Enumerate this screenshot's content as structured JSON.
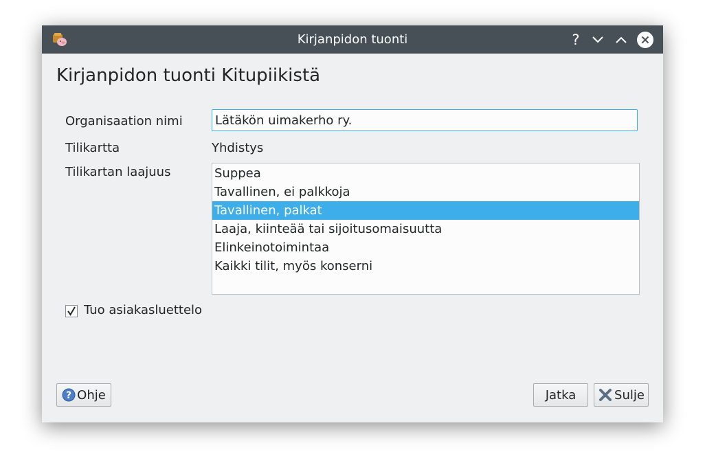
{
  "window": {
    "title": "Kirjanpidon tuonti",
    "controls": {
      "help": "?"
    }
  },
  "dialog": {
    "heading": "Kirjanpidon tuonti Kitupiikistä",
    "org_name_label": "Organisaation nimi",
    "org_name_value": "Lätäkön uimakerho ry.",
    "chart_label": "Tilikartta",
    "chart_value": "Yhdistys",
    "scope_label": "Tilikartan laajuus",
    "scope_options": [
      "Suppea",
      "Tavallinen, ei palkkoja",
      "Tavallinen, palkat",
      "Laaja, kiinteää tai sijoitusomaisuutta",
      "Elinkeinotoimintaa",
      "Kaikki tilit, myös konserni"
    ],
    "scope_selected": "Tavallinen, palkat",
    "import_customers_label": "Tuo asiakasluettelo",
    "import_customers_checked": true
  },
  "buttons": {
    "help": "Ohje",
    "next": "Jatka",
    "close": "Sulje"
  },
  "colors": {
    "titlebar": "#475057",
    "selection": "#3daee9",
    "window_bg": "#eff0f1"
  }
}
